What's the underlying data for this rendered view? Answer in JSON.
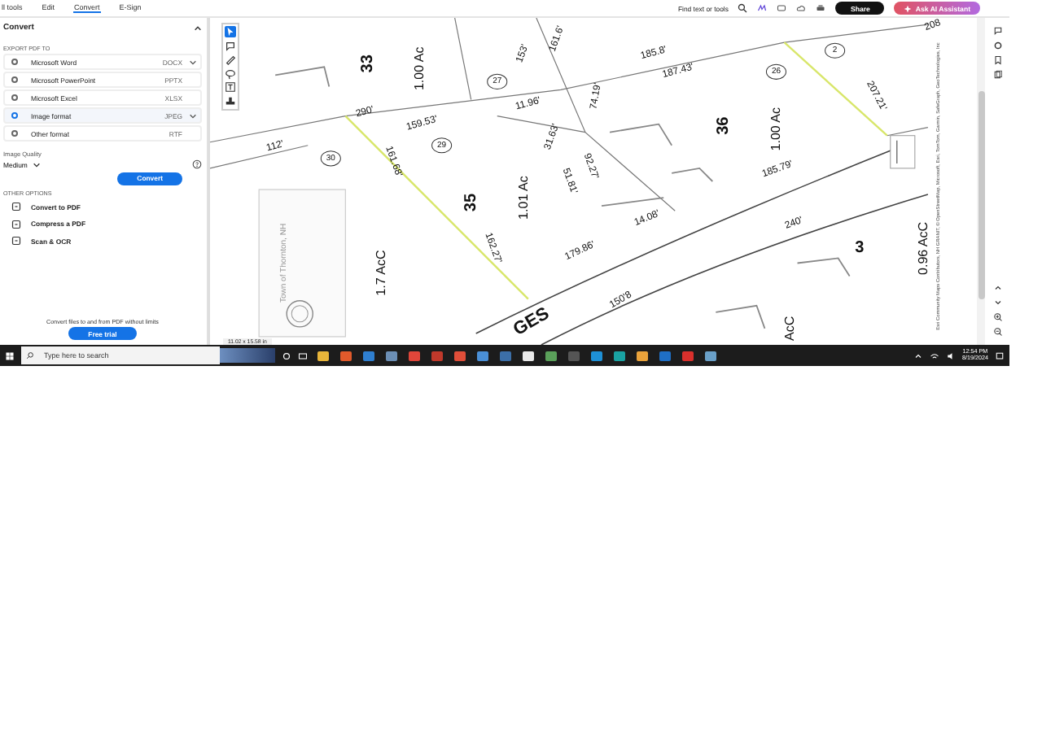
{
  "tabs": [
    {
      "label": "ll tools",
      "selected": false
    },
    {
      "label": "Edit",
      "selected": false
    },
    {
      "label": "Convert",
      "selected": true
    },
    {
      "label": "E-Sign",
      "selected": false
    }
  ],
  "top_bar": {
    "search_label": "Find text or tools",
    "share": "Share",
    "ai_assistant": "Ask AI Assistant"
  },
  "panel": {
    "title": "Convert",
    "export_heading": "EXPORT PDF TO",
    "formats": [
      {
        "name": "Microsoft Word",
        "ext": "DOCX",
        "selected": false,
        "has_menu": true
      },
      {
        "name": "Microsoft PowerPoint",
        "ext": "PPTX",
        "selected": false,
        "has_menu": false
      },
      {
        "name": "Microsoft Excel",
        "ext": "XLSX",
        "selected": false,
        "has_menu": false
      },
      {
        "name": "Image format",
        "ext": "JPEG",
        "selected": true,
        "has_menu": true
      },
      {
        "name": "Other format",
        "ext": "RTF",
        "selected": false,
        "has_menu": false
      }
    ],
    "quality_label": "Image Quality",
    "quality_value": "Medium",
    "convert_button": "Convert",
    "other_heading": "OTHER OPTIONS",
    "other_options": [
      "Convert to PDF",
      "Compress a PDF",
      "Scan & OCR"
    ],
    "promo": "Convert files to and from PDF without limits",
    "trial_button": "Free trial"
  },
  "map": {
    "labels": [
      {
        "text": "33",
        "kind": "lot"
      },
      {
        "text": "1.00 Ac",
        "kind": "area"
      },
      {
        "text": "27",
        "kind": "parcel"
      },
      {
        "text": "153'",
        "kind": "dim"
      },
      {
        "text": "161.6'",
        "kind": "dim"
      },
      {
        "text": "185.8'",
        "kind": "dim"
      },
      {
        "text": "187.43'",
        "kind": "dim"
      },
      {
        "text": "26",
        "kind": "parcel"
      },
      {
        "text": "2",
        "kind": "parcel"
      },
      {
        "text": "207.21'",
        "kind": "dim"
      },
      {
        "text": "208",
        "kind": "dim"
      },
      {
        "text": "290'",
        "kind": "dim"
      },
      {
        "text": "159.53'",
        "kind": "dim"
      },
      {
        "text": "11.96'",
        "kind": "dim"
      },
      {
        "text": "74.19'",
        "kind": "dim"
      },
      {
        "text": "112'",
        "kind": "dim"
      },
      {
        "text": "30",
        "kind": "parcel"
      },
      {
        "text": "29",
        "kind": "parcel"
      },
      {
        "text": "161.68'",
        "kind": "dim"
      },
      {
        "text": "31.63'",
        "kind": "dim"
      },
      {
        "text": "36",
        "kind": "lot"
      },
      {
        "text": "1.00 Ac",
        "kind": "area"
      },
      {
        "text": "51.81'",
        "kind": "dim"
      },
      {
        "text": "92.27'",
        "kind": "dim"
      },
      {
        "text": "185.79'",
        "kind": "dim"
      },
      {
        "text": "35",
        "kind": "lot"
      },
      {
        "text": "1.01 Ac",
        "kind": "area"
      },
      {
        "text": "14.08'",
        "kind": "dim"
      },
      {
        "text": "162.27'",
        "kind": "dim"
      },
      {
        "text": "179.86'",
        "kind": "dim"
      },
      {
        "text": "240'",
        "kind": "dim"
      },
      {
        "text": "3",
        "kind": "lot"
      },
      {
        "text": "0.96 AcC",
        "kind": "area"
      },
      {
        "text": "1.7 AcC",
        "kind": "area"
      },
      {
        "text": "GES",
        "kind": "road"
      },
      {
        "text": "150'8",
        "kind": "dim"
      },
      {
        "text": "AcC",
        "kind": "area"
      }
    ],
    "inset_title": "Town of Thornton, NH",
    "attribution": "Esri Community Maps Contributors, NH GRANIT, © OpenStreetMap, Microsoft, Esri, TomTom, Garmin, SafeGraph, GeoTechnologies, Inc",
    "page_size": "11.02 x 15.58 in"
  },
  "taskbar": {
    "search_placeholder": "Type here to search",
    "time": "12:54 PM",
    "date": "8/19/2024"
  }
}
